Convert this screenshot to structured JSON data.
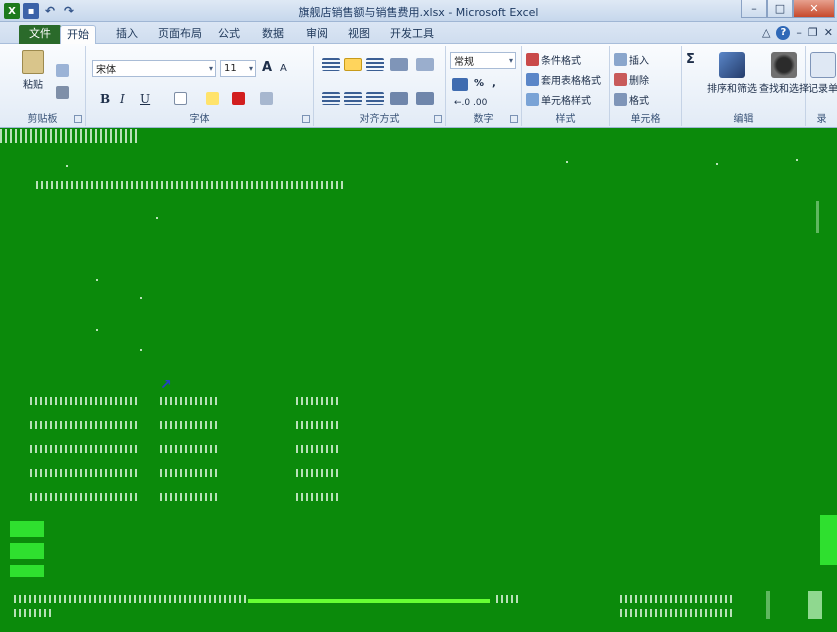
{
  "window": {
    "title": "旗舰店销售额与销售费用.xlsx - Microsoft Excel",
    "buttons": [
      "–",
      "□",
      "✕"
    ]
  },
  "tabs": [
    "文件",
    "开始",
    "插入",
    "页面布局",
    "公式",
    "数据",
    "审阅",
    "视图",
    "开发工具"
  ],
  "active_tab": "开始",
  "clipboard": {
    "paste": "粘贴",
    "group": "剪贴板"
  },
  "font": {
    "name": "宋体",
    "size": "11",
    "grow": "A",
    "shrink": "A",
    "bold": "B",
    "italic": "I",
    "underline": "U",
    "group": "字体"
  },
  "alignment": {
    "group": "对齐方式"
  },
  "number": {
    "format": "常规",
    "percent": "%",
    "comma": ",",
    "inc_dec": "←.0  .00",
    "group": "数字"
  },
  "styles": {
    "conditional": "条件格式",
    "table": "套用表格格式",
    "cell": "单元格样式",
    "group": "样式"
  },
  "cells": {
    "insert": "插入",
    "delete": "删除",
    "format": "格式",
    "group": "单元格"
  },
  "editing": {
    "sum": "Σ",
    "sort": "排序和筛选",
    "find": "查找和选择",
    "group": "编辑"
  },
  "record": {
    "label": "记录单",
    "group": "录"
  },
  "colors": {
    "sheet_bg": "#0b8a0b",
    "bright": "#66ff33",
    "file_tab": "#2a6a2a"
  }
}
